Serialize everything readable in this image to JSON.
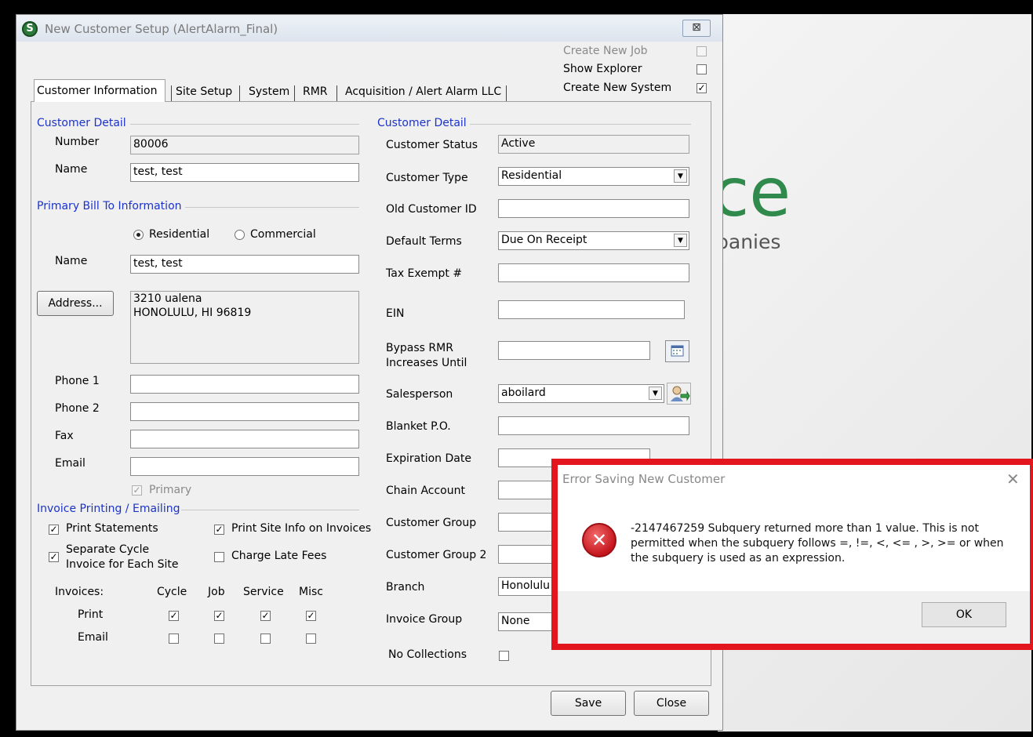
{
  "window": {
    "title": "New Customer Setup (AlertAlarm_Final)",
    "app_icon_letter": "S",
    "close_symbol": "⊠"
  },
  "background": {
    "logo_text": "ce",
    "logo_sub": "panies"
  },
  "top_options": [
    {
      "label": "Create New Job",
      "checked": false,
      "disabled": true
    },
    {
      "label": "Show Explorer",
      "checked": false,
      "disabled": false
    },
    {
      "label": "Create New System",
      "checked": true,
      "disabled": false
    }
  ],
  "tabs": [
    "Customer Information",
    "Site Setup",
    "System",
    "RMR",
    "Acquisition / Alert Alarm LLC"
  ],
  "left": {
    "customer_detail": {
      "section": "Customer Detail",
      "number_label": "Number",
      "number_value": "80006",
      "name_label": "Name",
      "name_value": "test, test"
    },
    "bill_to": {
      "section": "Primary Bill To Information",
      "residential_label": "Residential",
      "commercial_label": "Commercial",
      "name_label": "Name",
      "name_value": "test, test",
      "address_button": "Address...",
      "address_line1": "3210 ualena",
      "address_line2": "HONOLULU, HI  96819",
      "phone1_label": "Phone 1",
      "phone2_label": "Phone 2",
      "fax_label": "Fax",
      "email_label": "Email",
      "primary_label": "Primary"
    },
    "invoice": {
      "section": "Invoice Printing / Emailing",
      "print_statements": "Print Statements",
      "print_site_info": "Print Site Info on Invoices",
      "separate_cycle_1": "Separate Cycle",
      "separate_cycle_2": "Invoice for Each Site",
      "charge_late_fees": "Charge Late Fees",
      "invoices_label": "Invoices:",
      "col_cycle": "Cycle",
      "col_job": "Job",
      "col_service": "Service",
      "col_misc": "Misc",
      "print_row": "Print",
      "email_row": "Email"
    }
  },
  "right": {
    "section": "Customer Detail",
    "status_label": "Customer Status",
    "status_value": "Active",
    "type_label": "Customer Type",
    "type_value": "Residential",
    "old_id_label": "Old Customer ID",
    "terms_label": "Default Terms",
    "terms_value": "Due On Receipt",
    "tax_label": "Tax Exempt #",
    "ein_label": "EIN",
    "bypass_label_1": "Bypass RMR",
    "bypass_label_2": "Increases Until",
    "salesperson_label": "Salesperson",
    "salesperson_value": "aboilard",
    "blanket_label": "Blanket P.O.",
    "expiration_label": "Expiration Date",
    "chain_label": "Chain Account",
    "group_label": "Customer Group",
    "group2_label": "Customer Group 2",
    "branch_label": "Branch",
    "branch_value": "Honolulu",
    "invoice_group_label": "Invoice Group",
    "invoice_group_value": "None",
    "no_collections_label": "No Collections"
  },
  "buttons": {
    "save": "Save",
    "close": "Close"
  },
  "dialog": {
    "title": "Error Saving New Customer",
    "message": "-2147467259 Subquery returned more than 1 value. This is not permitted when the subquery follows =, !=, <, <= , >, >= or when the subquery is used as an expression.",
    "ok": "OK",
    "close_symbol": "✕",
    "error_symbol": "✕"
  },
  "colors": {
    "section_blue": "#1c33c8",
    "highlight_red": "#e3161d",
    "logo_green": "#2f8a4b"
  }
}
